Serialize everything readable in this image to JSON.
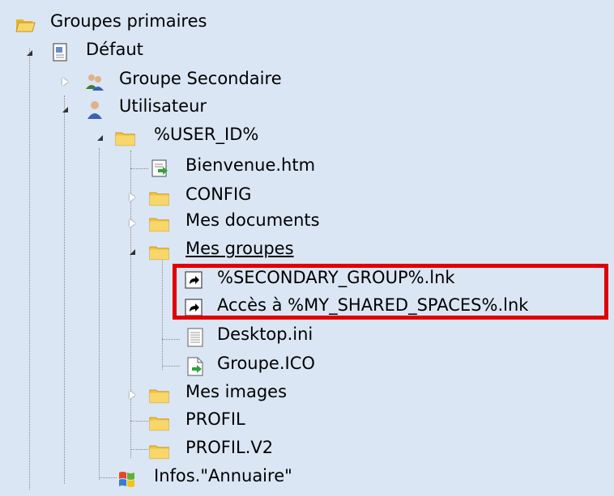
{
  "tree": {
    "root": {
      "label": "Groupes primaires",
      "icon": "folder-open-icon"
    },
    "defaut": {
      "label": "Défaut",
      "icon": "document-icon"
    },
    "groupe_secondaire": {
      "label": "Groupe Secondaire",
      "icon": "users-icon"
    },
    "utilisateur": {
      "label": "Utilisateur",
      "icon": "user-icon"
    },
    "user_id": {
      "label": "%USER_ID%",
      "icon": "folder-icon"
    },
    "bienvenue": {
      "label": "Bienvenue.htm",
      "icon": "html-file-icon"
    },
    "config": {
      "label": "CONFIG",
      "icon": "folder-icon"
    },
    "mes_documents": {
      "label": "Mes documents",
      "icon": "folder-icon"
    },
    "mes_groupes": {
      "label": "Mes groupes",
      "icon": "folder-icon"
    },
    "secondary_group_lnk": {
      "label": "%SECONDARY_GROUP%.lnk",
      "icon": "shortcut-icon"
    },
    "shared_spaces_lnk": {
      "label": "Accès à %MY_SHARED_SPACES%.lnk",
      "icon": "shortcut-icon"
    },
    "desktop_ini": {
      "label": "Desktop.ini",
      "icon": "text-file-icon"
    },
    "groupe_ico": {
      "label": "Groupe.ICO",
      "icon": "file-icon"
    },
    "mes_images": {
      "label": "Mes images",
      "icon": "folder-icon"
    },
    "profil": {
      "label": "PROFIL",
      "icon": "folder-icon"
    },
    "profil_v2": {
      "label": "PROFIL.V2",
      "icon": "folder-icon"
    },
    "infos_annuaire": {
      "label": "Infos.\"Annuaire\"",
      "icon": "windows-logo-icon"
    }
  },
  "colors": {
    "background": "#dbe6f4",
    "highlight_border": "#e00000",
    "folder": "#f3c43a"
  }
}
